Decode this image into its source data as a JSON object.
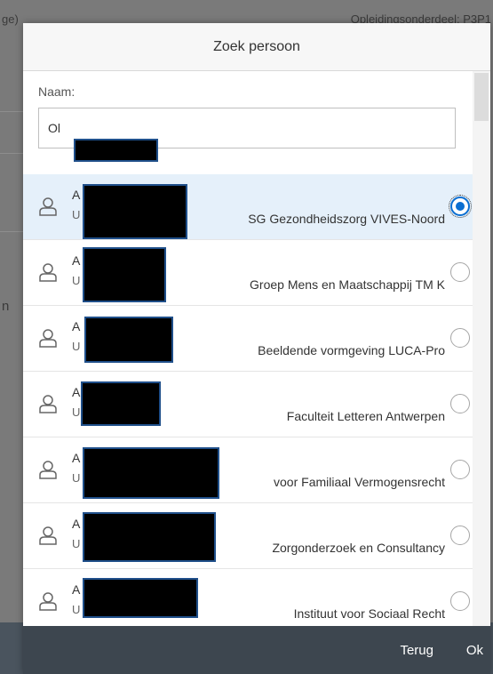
{
  "background": {
    "left_text": "ge)",
    "right_text": "Opleidingsonderdeel: P3P1",
    "n_text": "n"
  },
  "dialog": {
    "title": "Zoek persoon",
    "search": {
      "label": "Naam:",
      "value_prefix": "Ol"
    },
    "results": [
      {
        "initial": "A",
        "sub_prefix": "U",
        "org": "SG Gezondheidszorg VIVES-Noord",
        "selected": true
      },
      {
        "initial": "A",
        "sub_prefix": "U",
        "org": "Groep Mens en Maatschappij TM K",
        "selected": false
      },
      {
        "initial": "A",
        "sub_prefix": "U",
        "org": "Beeldende vormgeving LUCA-Pro",
        "selected": false
      },
      {
        "initial": "A",
        "sub_prefix": "U",
        "org": "Faculteit Letteren Antwerpen",
        "selected": false
      },
      {
        "initial": "A",
        "sub_prefix": "U",
        "org": "voor Familiaal Vermogensrecht",
        "selected": false
      },
      {
        "initial": "A",
        "sub_prefix": "U",
        "org": "Zorgonderzoek en Consultancy",
        "selected": false
      },
      {
        "initial": "A",
        "sub_prefix": "U",
        "org": "Instituut voor Sociaal Recht",
        "selected": false
      }
    ],
    "footer": {
      "back_label": "Terug",
      "ok_label": "Ok"
    }
  },
  "colors": {
    "accent": "#0a6ed1",
    "selected_row": "#e5f0fa",
    "footer": "#3d464f"
  }
}
